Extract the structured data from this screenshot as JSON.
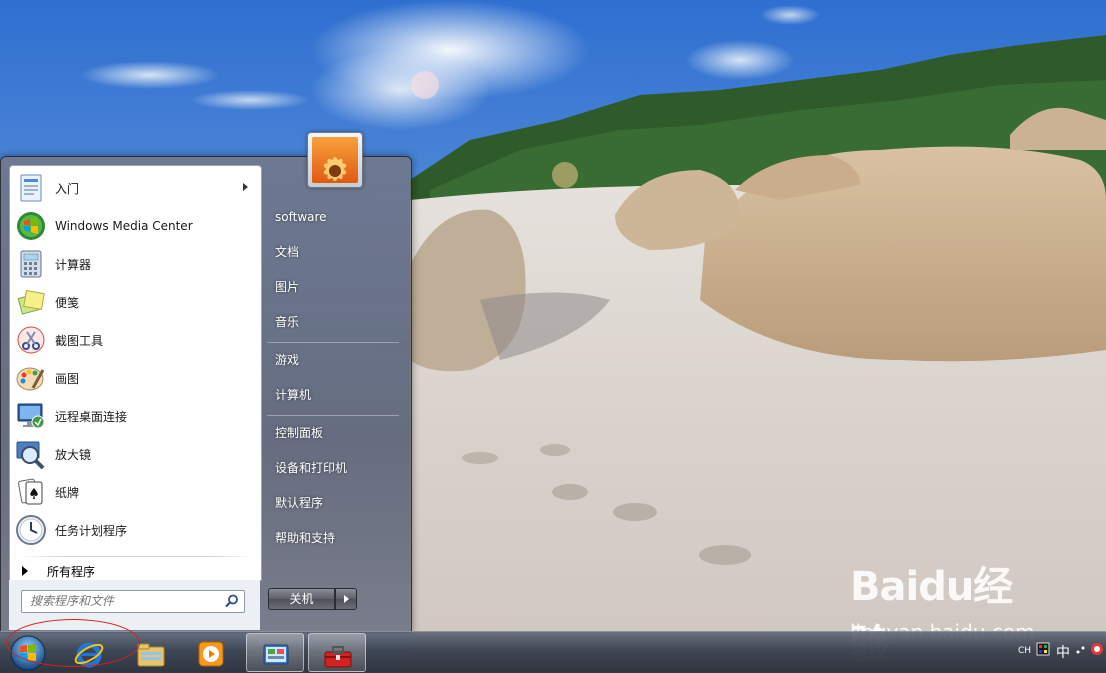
{
  "start_menu": {
    "programs": [
      {
        "label": "入门",
        "icon": "getting-started-icon",
        "has_submenu": true
      },
      {
        "label": "Windows Media Center",
        "icon": "media-center-icon"
      },
      {
        "label": "计算器",
        "icon": "calculator-icon"
      },
      {
        "label": "便笺",
        "icon": "sticky-notes-icon"
      },
      {
        "label": "截图工具",
        "icon": "snipping-tool-icon"
      },
      {
        "label": "画图",
        "icon": "paint-icon"
      },
      {
        "label": "远程桌面连接",
        "icon": "remote-desktop-icon"
      },
      {
        "label": "放大镜",
        "icon": "magnifier-icon"
      },
      {
        "label": "纸牌",
        "icon": "solitaire-icon"
      },
      {
        "label": "任务计划程序",
        "icon": "task-scheduler-icon"
      }
    ],
    "all_programs": "所有程序",
    "search": {
      "placeholder": "搜索程序和文件"
    },
    "right_items": [
      "software",
      "文档",
      "图片",
      "音乐",
      "游戏",
      "计算机",
      "控制面板",
      "设备和打印机",
      "默认程序",
      "帮助和支持"
    ],
    "shutdown_label": "关机"
  },
  "taskbar": {
    "start_button": "start-orb-icon",
    "pinned": [
      "internet-explorer-icon",
      "windows-explorer-icon",
      "media-player-icon",
      "control-panel-icon",
      "toolbox-icon"
    ],
    "tray": {
      "language": "CH",
      "ime": "中"
    }
  },
  "watermark": {
    "logo": "Baidu经验",
    "url": "jingyan.baidu.com"
  },
  "colors": {
    "accent_annotation": "#d91f1f"
  }
}
